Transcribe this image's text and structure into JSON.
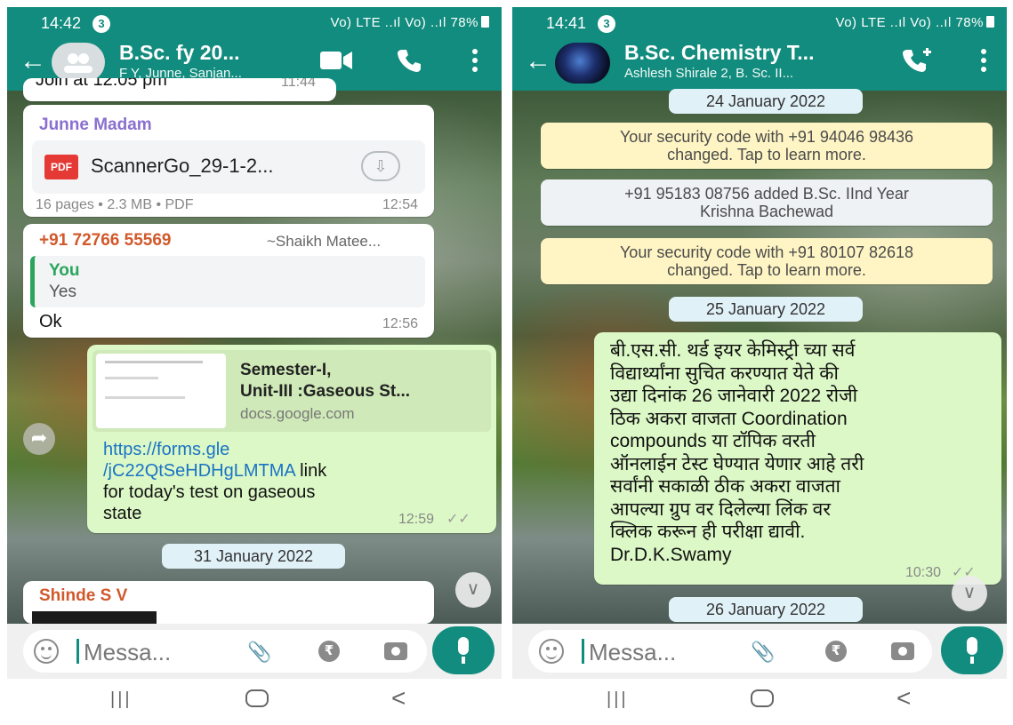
{
  "left": {
    "status": {
      "time": "14:42",
      "badge": "3",
      "indicators": "Vo) LTE ..ıl Vo) ..ıl",
      "battery": "78%"
    },
    "header": {
      "title": "B.Sc. fy  20...",
      "subtitle": "F Y, Junne, Sanjan..."
    },
    "partial_top": {
      "text": "Join at 12:05 pm",
      "time": "11:44"
    },
    "doc_msg": {
      "sender": "Junne Madam",
      "badge": "PDF",
      "filename": "ScannerGo_29-1-2...",
      "info": "16 pages • 2.3 MB • PDF",
      "time": "12:54"
    },
    "reply_msg": {
      "sender": "+91 72766 55569",
      "alias": "~Shaikh Matee...",
      "quoted_name": "You",
      "quoted_text": "Yes",
      "text": "Ok",
      "time": "12:56"
    },
    "link_msg": {
      "preview_title_1": "Semester-I,",
      "preview_title_2": "Unit-III :Gaseous St...",
      "preview_domain": "docs.google.com",
      "link_1": "https://forms.gle",
      "link_2": "/jC22QtSeHDHgLMTMA",
      "text_1": " link",
      "text_2": "for today's test on gaseous",
      "text_3": "state",
      "time": "12:59",
      "ticks": "✓✓"
    },
    "date_chip": "31 January 2022",
    "bottom_msg": {
      "sender": "Shinde S V"
    },
    "input": {
      "placeholder": "Messa..."
    }
  },
  "right": {
    "status": {
      "time": "14:41",
      "badge": "3",
      "indicators": "Vo) LTE ..ıl Vo) ..ıl",
      "battery": "78%"
    },
    "header": {
      "title": "B.Sc. Chemistry T...",
      "subtitle": "Ashlesh Shirale 2, B. Sc. II..."
    },
    "date_chip_1": "24 January 2022",
    "sys_1": {
      "line1": "Your security code with +91 94046 98436",
      "line2": "changed. Tap to learn more."
    },
    "sys_2": {
      "line1": "+91 95183 08756 added B.Sc. IInd Year",
      "line2": "Krishna Bachewad"
    },
    "sys_3": {
      "line1": "Your security code with +91 80107 82618",
      "line2": "changed. Tap to learn more."
    },
    "date_chip_2": "25 January 2022",
    "marathi_msg": {
      "lines": [
        "बी.एस.सी. थर्ड इयर केमिस्ट्री च्या सर्व",
        "विद्यार्थ्यांना सुचित करण्यात येते की",
        "उद्या दिनांक 26 जानेवारी 2022 रोजी",
        "ठिक अकरा वाजता Coordination",
        "compounds या टॉपिक वरती",
        "ऑनलाईन टेस्ट घेण्यात येणार आहे तरी",
        "सर्वांनी सकाळी ठीक अकरा वाजता",
        "आपल्या ग्रुप वर दिलेल्या लिंक वर",
        "क्लिक करून ही परीक्षा द्यावी.",
        "Dr.D.K.Swamy"
      ],
      "time": "10:30",
      "ticks": "✓✓"
    },
    "date_chip_3": "26 January 2022",
    "input": {
      "placeholder": "Messa..."
    }
  },
  "icons": {
    "back": "arrow-left",
    "video": "video-camera",
    "call": "phone",
    "add_call": "phone-plus",
    "menu": "three-dots-vertical",
    "attach": "paperclip",
    "rupee": "rupee",
    "camera": "camera",
    "mic": "microphone",
    "emoji": "smiley",
    "scroll_down": "double-chevron-down",
    "forward": "forward-arrow"
  },
  "colors": {
    "header": "#128c7e",
    "outgoing": "#dcf8c6",
    "incoming": "#ffffff",
    "system": "#fff5c4",
    "link": "#1a73c5"
  },
  "nav": {
    "recent": "|||",
    "back": "<"
  }
}
